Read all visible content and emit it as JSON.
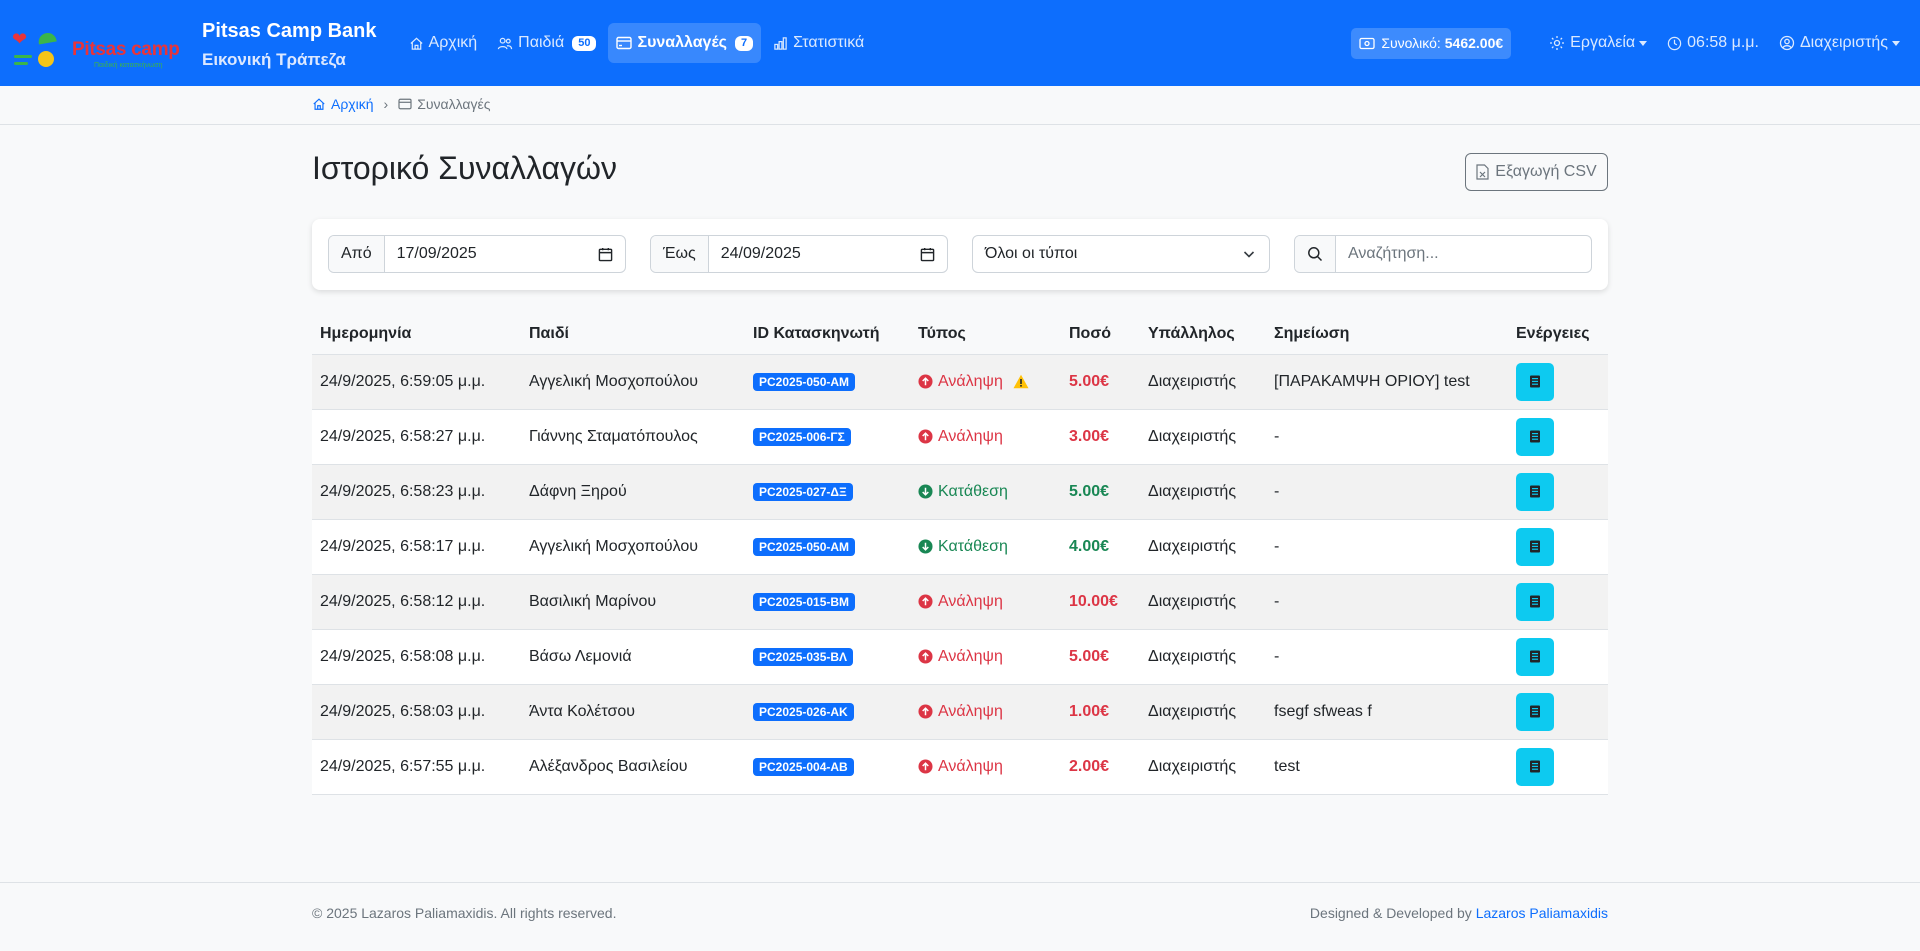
{
  "navbar": {
    "logo_text": "Pitsas camp",
    "logo_subtext": "Παιδική κατασκήνωση",
    "brand_title": "Pitsas Camp Bank",
    "brand_subtitle": "Εικονική Τράπεζα",
    "nav_items": [
      {
        "label": "Αρχική",
        "icon": "house-icon"
      },
      {
        "label": "Παιδιά",
        "icon": "people-icon",
        "badge": "50"
      },
      {
        "label": "Συναλλαγές",
        "icon": "credit-card-icon",
        "badge": "7",
        "active": true
      },
      {
        "label": "Στατιστικά",
        "icon": "bar-chart-icon"
      }
    ],
    "total_label": "Συνολικό:",
    "total_value": "5462.00€",
    "tools_label": "Εργαλεία",
    "clock": "06:58 μ.μ.",
    "user_label": "Διαχειριστής"
  },
  "breadcrumb": {
    "home": "Αρχική",
    "separator": "›",
    "current": "Συναλλαγές"
  },
  "page": {
    "title": "Ιστορικό Συναλλαγών",
    "export_label": "Εξαγωγή CSV"
  },
  "filters": {
    "from_label": "Από",
    "from_value": "17/09/2025",
    "to_label": "Έως",
    "to_value": "24/09/2025",
    "type_selected": "Όλοι οι τύποι",
    "search_placeholder": "Αναζήτηση..."
  },
  "table": {
    "headers": [
      "Ημερομηνία",
      "Παιδί",
      "ID Κατασκηνωτή",
      "Τύπος",
      "Ποσό",
      "Υπάλληλος",
      "Σημείωση",
      "Ενέργειες"
    ],
    "rows": [
      {
        "date": "24/9/2025, 6:59:05 μ.μ.",
        "child": "Αγγελική Μοσχοπούλου",
        "id": "PC2025-050-ΑΜ",
        "type": "Ανάληψη",
        "kind": "withdraw",
        "warning": true,
        "amount": "5.00€",
        "employee": "Διαχειριστής",
        "note": "[ΠΑΡΑΚΑΜΨΗ ΟΡΙΟΥ] test"
      },
      {
        "date": "24/9/2025, 6:58:27 μ.μ.",
        "child": "Γιάννης Σταματόπουλος",
        "id": "PC2025-006-ΓΣ",
        "type": "Ανάληψη",
        "kind": "withdraw",
        "warning": false,
        "amount": "3.00€",
        "employee": "Διαχειριστής",
        "note": "-"
      },
      {
        "date": "24/9/2025, 6:58:23 μ.μ.",
        "child": "Δάφνη Ξηρού",
        "id": "PC2025-027-ΔΞ",
        "type": "Κατάθεση",
        "kind": "deposit",
        "warning": false,
        "amount": "5.00€",
        "employee": "Διαχειριστής",
        "note": "-"
      },
      {
        "date": "24/9/2025, 6:58:17 μ.μ.",
        "child": "Αγγελική Μοσχοπούλου",
        "id": "PC2025-050-ΑΜ",
        "type": "Κατάθεση",
        "kind": "deposit",
        "warning": false,
        "amount": "4.00€",
        "employee": "Διαχειριστής",
        "note": "-"
      },
      {
        "date": "24/9/2025, 6:58:12 μ.μ.",
        "child": "Βασιλική Μαρίνου",
        "id": "PC2025-015-ΒΜ",
        "type": "Ανάληψη",
        "kind": "withdraw",
        "warning": false,
        "amount": "10.00€",
        "employee": "Διαχειριστής",
        "note": "-"
      },
      {
        "date": "24/9/2025, 6:58:08 μ.μ.",
        "child": "Βάσω Λεμονιά",
        "id": "PC2025-035-ΒΛ",
        "type": "Ανάληψη",
        "kind": "withdraw",
        "warning": false,
        "amount": "5.00€",
        "employee": "Διαχειριστής",
        "note": "-"
      },
      {
        "date": "24/9/2025, 6:58:03 μ.μ.",
        "child": "Άντα Κολέτσου",
        "id": "PC2025-026-ΑΚ",
        "type": "Ανάληψη",
        "kind": "withdraw",
        "warning": false,
        "amount": "1.00€",
        "employee": "Διαχειριστής",
        "note": "fsegf sfweas f"
      },
      {
        "date": "24/9/2025, 6:57:55 μ.μ.",
        "child": "Αλέξανδρος Βασιλείου",
        "id": "PC2025-004-ΑΒ",
        "type": "Ανάληψη",
        "kind": "withdraw",
        "warning": false,
        "amount": "2.00€",
        "employee": "Διαχειριστής",
        "note": "test"
      }
    ]
  },
  "footer": {
    "copyright": "© 2025 Lazaros Paliamaxidis. All rights reserved.",
    "credit_prefix": "Designed & Developed by",
    "credit_name": "Lazaros Paliamaxidis"
  },
  "colors": {
    "primary": "#0d6efd",
    "danger": "#dc3545",
    "success": "#198754",
    "info": "#0dcaf0",
    "warning": "#ffc107"
  }
}
